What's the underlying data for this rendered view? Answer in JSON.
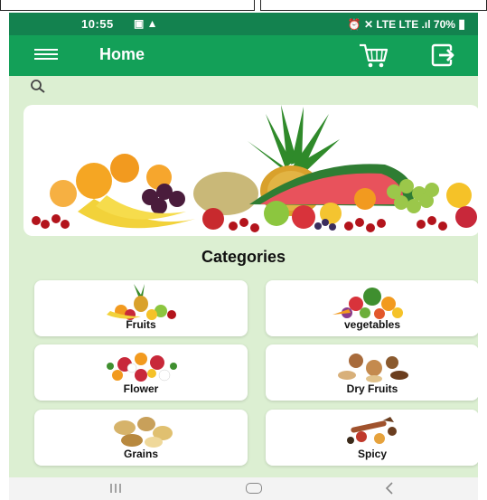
{
  "status_bar": {
    "time": "10:55",
    "status_icons": "▣ ▲",
    "network": "⏰ ✕ LTE LTE .ıl",
    "battery": "70%"
  },
  "app_bar": {
    "title": "Home",
    "icons": [
      "menu-icon",
      "cart-icon",
      "logout-icon"
    ]
  },
  "search": {
    "icon": "search-icon"
  },
  "categories": {
    "title": "Categories",
    "items": [
      {
        "label": "Fruits"
      },
      {
        "label": "vegetables"
      },
      {
        "label": "Flower"
      },
      {
        "label": "Dry Fruits"
      },
      {
        "label": "Grains"
      },
      {
        "label": "Spicy"
      }
    ]
  },
  "colors": {
    "status_bar": "#13824f",
    "app_bar": "#13a058",
    "background": "#dcefd2"
  }
}
